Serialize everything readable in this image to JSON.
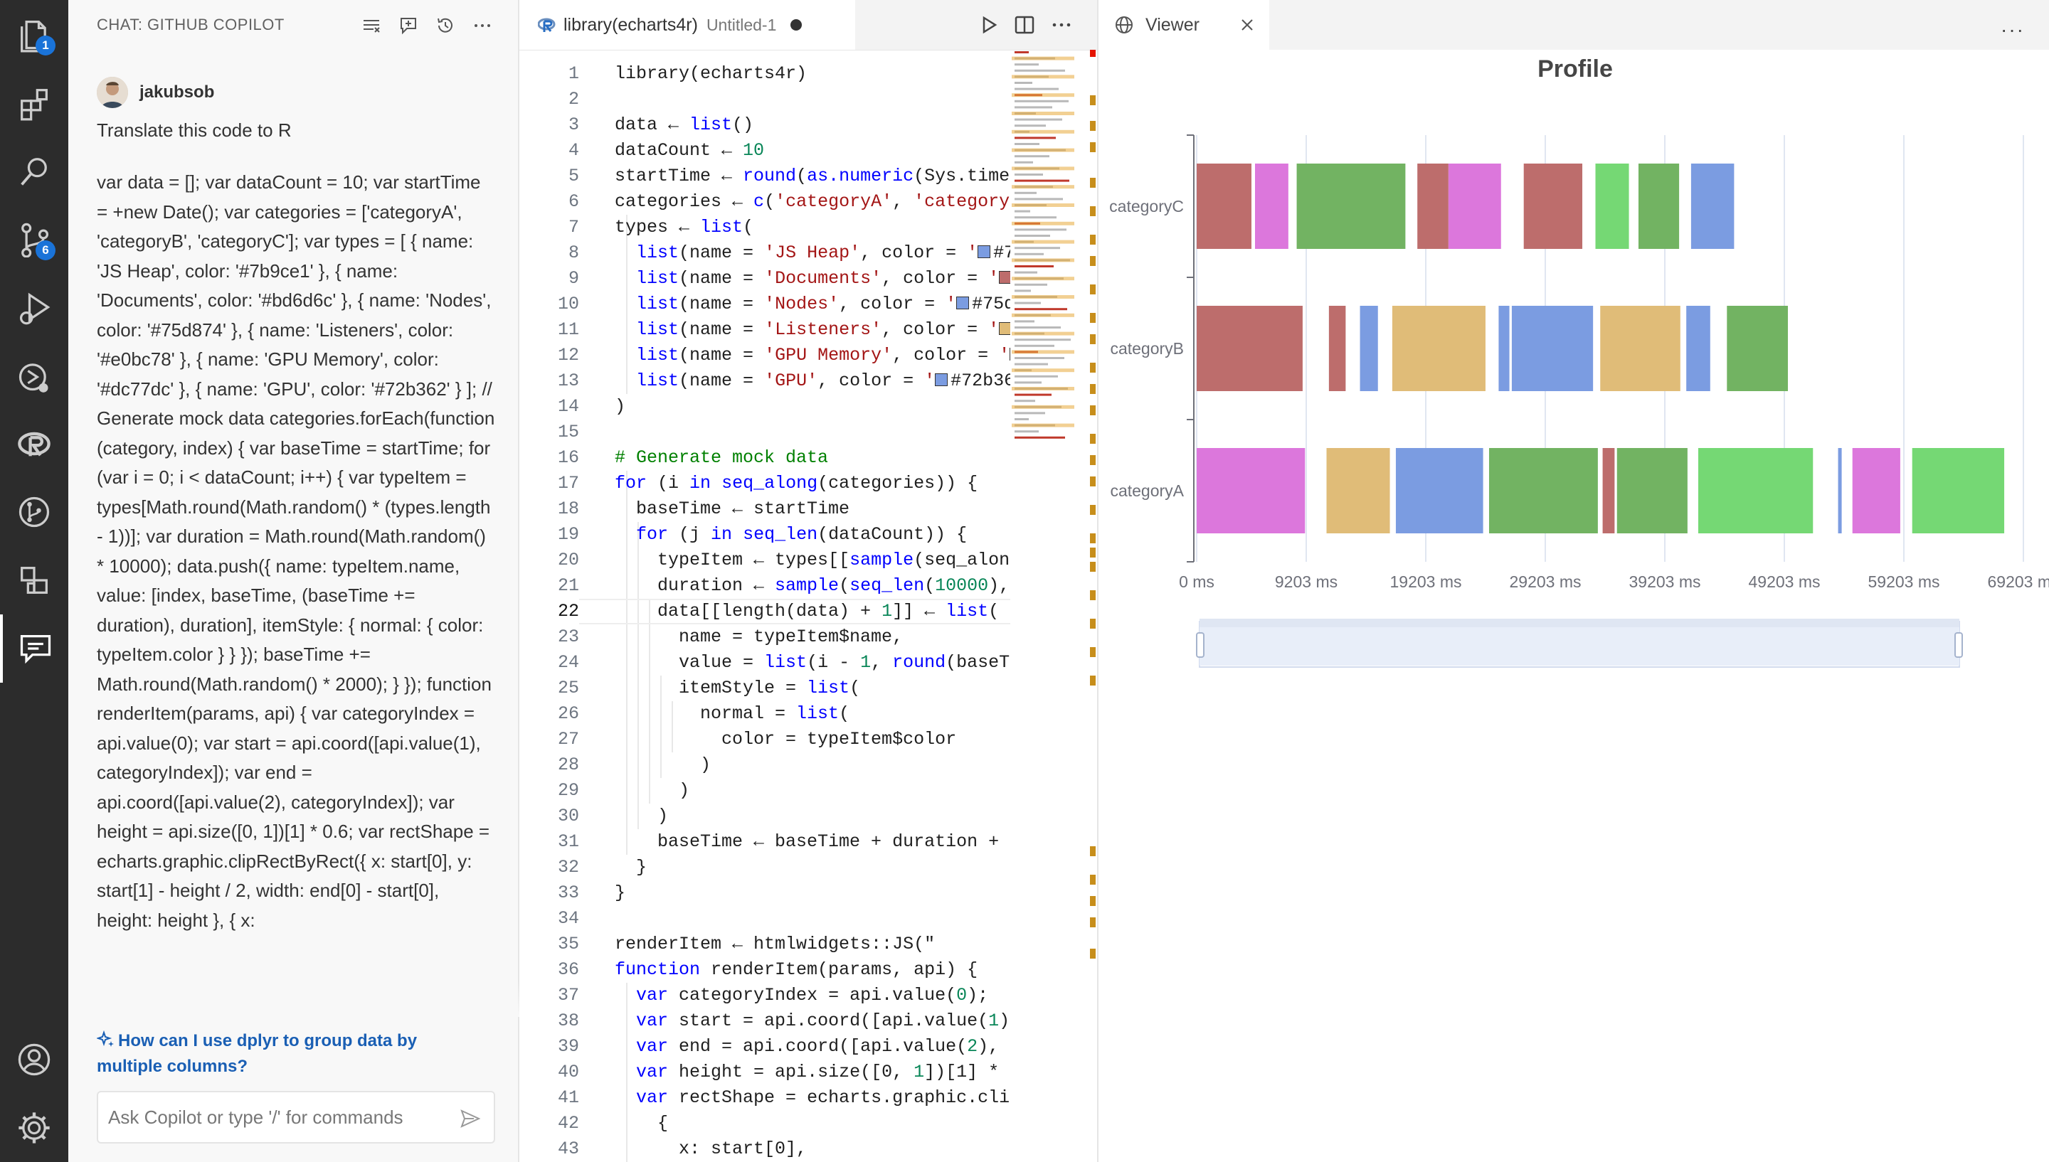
{
  "activity_bar": {
    "items": [
      {
        "name": "explorer-icon",
        "badge": "1"
      },
      {
        "name": "extensions-icon",
        "badge": ""
      },
      {
        "name": "search-icon",
        "badge": ""
      },
      {
        "name": "source-control-icon",
        "badge": "6"
      },
      {
        "name": "run-debug-icon",
        "badge": ""
      },
      {
        "name": "remote-explorer-icon",
        "badge": ""
      },
      {
        "name": "r-icon",
        "badge": ""
      },
      {
        "name": "git-graph-icon",
        "badge": ""
      },
      {
        "name": "extensions-2-icon",
        "badge": ""
      },
      {
        "name": "chat-icon",
        "badge": ""
      },
      {
        "name": "account-icon",
        "badge": ""
      },
      {
        "name": "settings-gear-icon",
        "badge": ""
      }
    ]
  },
  "chat": {
    "header": "CHAT: GITHUB COPILOT",
    "user": "jakubsob",
    "prompt": "Translate this code to R",
    "response": "var data = []; var dataCount = 10; var startTime = +new Date(); var categories = ['categoryA', 'categoryB', 'categoryC']; var types = [ { name: 'JS Heap', color: '#7b9ce1' }, { name: 'Documents', color: '#bd6d6c' }, { name: 'Nodes', color: '#75d874' }, { name: 'Listeners', color: '#e0bc78' }, { name: 'GPU Memory', color: '#dc77dc' }, { name: 'GPU', color: '#72b362' } ]; // Generate mock data categories.forEach(function (category, index) { var baseTime = startTime; for (var i = 0; i < dataCount; i++) { var typeItem = types[Math.round(Math.random() * (types.length - 1))]; var duration = Math.round(Math.random() * 10000); data.push({ name: typeItem.name, value: [index, baseTime, (baseTime += duration), duration], itemStyle: { normal: { color: typeItem.color } } }); baseTime += Math.round(Math.random() * 2000); } }); function renderItem(params, api) { var categoryIndex = api.value(0); var start = api.coord([api.value(1), categoryIndex]); var end = api.coord([api.value(2), categoryIndex]); var height = api.size([0, 1])[1] * 0.6; var rectShape = echarts.graphic.clipRectByRect({ x: start[0], y: start[1] - height / 2, width: end[0] - start[0], height: height }, { x:",
    "followup": "How can I use dplyr to group data by multiple columns?",
    "input_placeholder": "Ask Copilot or type '/' for commands"
  },
  "editor": {
    "tab_name": "library(echarts4r)",
    "tab_path": "Untitled-1",
    "current_line": 22,
    "lines": [
      "library(echarts4r)",
      "",
      "data ← list()",
      "dataCount ← 10",
      "startTime ← round(as.numeric(Sys.time",
      "categories ← c('categoryA', 'category",
      "types ← list(",
      "  list(name = 'JS Heap', color = '■#7",
      "  list(name = 'Documents', color = '■",
      "  list(name = 'Nodes', color = '■#75d",
      "  list(name = 'Listeners', color = '■",
      "  list(name = 'GPU Memory', color = '■",
      "  list(name = 'GPU', color = '■#72b36",
      ")",
      "",
      "# Generate mock data",
      "for (i in seq_along(categories)) {",
      "  baseTime ← startTime",
      "  for (j in seq_len(dataCount)) {",
      "    typeItem ← types[[sample(seq_alon",
      "    duration ← sample(seq_len(10000),",
      "    data[[length(data) + 1]] ← list(",
      "      name = typeItem$name,",
      "      value = list(i - 1, round(baseTi",
      "      itemStyle = list(",
      "        normal = list(",
      "          color = typeItem$color",
      "        )",
      "      )",
      "    )",
      "    baseTime ← baseTime + duration +",
      "  }",
      "}",
      "",
      "renderItem ← htmlwidgets::JS(\"",
      "function renderItem(params, api) {",
      "  var categoryIndex = api.value(0);",
      "  var start = api.coord([api.value(1),",
      "  var end = api.coord([api.value(2), c",
      "  var height = api.size([0, 1])[1] * 0",
      "  var rectShape = echarts.graphic.clip",
      "    {",
      "      x: start[0],",
      "      y: start[1] - height / 2,"
    ]
  },
  "viewer": {
    "tab_label": "Viewer"
  },
  "colors": {
    "js_heap": "#7b9ce1",
    "documents": "#bd6d6c",
    "nodes": "#75d874",
    "listeners": "#e0bc78",
    "gpu_memory": "#dc77dc",
    "gpu": "#72b362"
  },
  "chart_data": {
    "type": "bar",
    "subtype": "custom-profile-timeline",
    "title": "Profile",
    "categories": [
      "categoryA",
      "categoryB",
      "categoryC"
    ],
    "xlim": [
      0,
      72000
    ],
    "x_ticks": [
      "0 ms",
      "9203 ms",
      "19203 ms",
      "29203 ms",
      "39203 ms",
      "49203 ms",
      "59203 ms",
      "69203 ms"
    ],
    "x_tick_values": [
      0,
      9203,
      19203,
      29203,
      39203,
      49203,
      59203,
      69203
    ],
    "datazoom_slider": true,
    "series": [
      {
        "category": "categoryC",
        "segments": [
          {
            "start": 0,
            "end": 4600,
            "type": "Documents"
          },
          {
            "start": 4900,
            "end": 7700,
            "type": "GPU Memory"
          },
          {
            "start": 8400,
            "end": 17500,
            "type": "GPU"
          },
          {
            "start": 18500,
            "end": 21100,
            "type": "Documents"
          },
          {
            "start": 21100,
            "end": 25500,
            "type": "GPU Memory"
          },
          {
            "start": 27400,
            "end": 32300,
            "type": "Documents"
          },
          {
            "start": 33400,
            "end": 36200,
            "type": "Nodes"
          },
          {
            "start": 37000,
            "end": 40400,
            "type": "GPU"
          },
          {
            "start": 41400,
            "end": 45000,
            "type": "JS Heap"
          }
        ]
      },
      {
        "category": "categoryB",
        "segments": [
          {
            "start": 0,
            "end": 8900,
            "type": "Documents"
          },
          {
            "start": 11100,
            "end": 12500,
            "type": "Documents"
          },
          {
            "start": 13700,
            "end": 15200,
            "type": "JS Heap"
          },
          {
            "start": 16400,
            "end": 24200,
            "type": "Listeners"
          },
          {
            "start": 25300,
            "end": 26200,
            "type": "JS Heap"
          },
          {
            "start": 26400,
            "end": 33200,
            "type": "JS Heap"
          },
          {
            "start": 33800,
            "end": 40500,
            "type": "Listeners"
          },
          {
            "start": 41000,
            "end": 43000,
            "type": "JS Heap"
          },
          {
            "start": 44400,
            "end": 49500,
            "type": "GPU"
          }
        ]
      },
      {
        "category": "categoryA",
        "segments": [
          {
            "start": 0,
            "end": 9100,
            "type": "GPU Memory"
          },
          {
            "start": 10900,
            "end": 16200,
            "type": "Listeners"
          },
          {
            "start": 16700,
            "end": 24000,
            "type": "JS Heap"
          },
          {
            "start": 24500,
            "end": 33600,
            "type": "GPU"
          },
          {
            "start": 34000,
            "end": 35000,
            "type": "Documents"
          },
          {
            "start": 35200,
            "end": 41100,
            "type": "GPU"
          },
          {
            "start": 42000,
            "end": 51600,
            "type": "Nodes"
          },
          {
            "start": 53700,
            "end": 54000,
            "type": "JS Heap"
          },
          {
            "start": 54900,
            "end": 58900,
            "type": "GPU Memory"
          },
          {
            "start": 59900,
            "end": 67600,
            "type": "Nodes"
          }
        ]
      }
    ]
  }
}
